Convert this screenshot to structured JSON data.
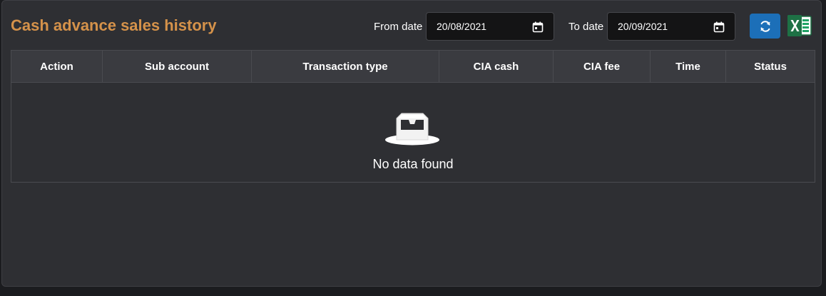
{
  "page": {
    "title": "Cash advance sales history"
  },
  "filters": {
    "from_label": "From date",
    "from_value": "20/08/2021",
    "to_label": "To date",
    "to_value": "20/09/2021"
  },
  "actions": {
    "refresh_icon": "refresh-icon",
    "export_icon": "excel-icon"
  },
  "table": {
    "columns": [
      "Action",
      "Sub account",
      "Transaction type",
      "CIA cash",
      "CIA fee",
      "Time",
      "Status"
    ],
    "rows": [],
    "empty_text": "No data found"
  },
  "colors": {
    "title": "#d5924a",
    "panel": "#2e2f33",
    "accent_blue": "#1c6fb8",
    "excel_green": "#1e7145"
  }
}
